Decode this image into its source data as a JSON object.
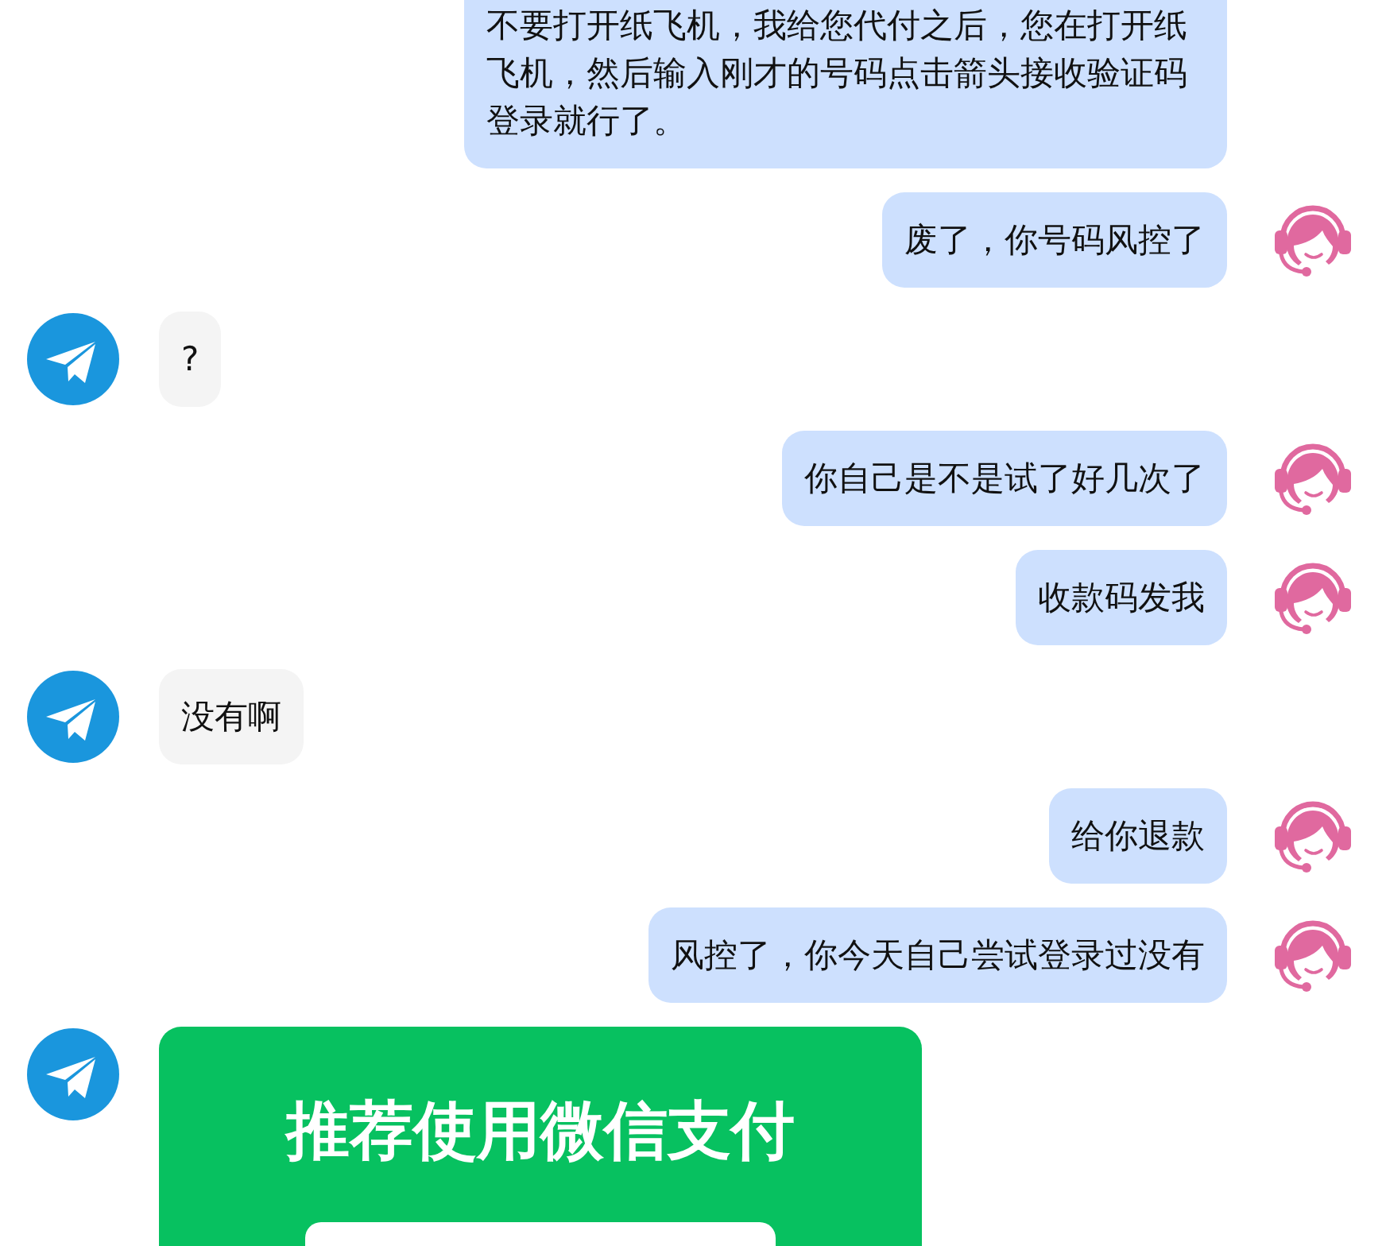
{
  "messages": [
    {
      "kind": "outgoing_text",
      "avatar_shown": false,
      "text": "不要打开纸飞机，我给您代付之后，您在打开纸飞机，然后输入刚才的号码点击箭头接收验证码登录就行了。"
    },
    {
      "kind": "outgoing_text",
      "avatar_shown": true,
      "text": "废了，你号码风控了"
    },
    {
      "kind": "incoming_text",
      "avatar_shown": true,
      "text": "?"
    },
    {
      "kind": "outgoing_text",
      "avatar_shown": true,
      "text": "你自己是不是试了好几次了"
    },
    {
      "kind": "outgoing_text",
      "avatar_shown": true,
      "text": "收款码发我"
    },
    {
      "kind": "incoming_text",
      "avatar_shown": true,
      "text": "没有啊"
    },
    {
      "kind": "outgoing_text",
      "avatar_shown": true,
      "text": "给你退款"
    },
    {
      "kind": "outgoing_text",
      "avatar_shown": true,
      "text": "风控了，你今天自己尝试登录过没有"
    },
    {
      "kind": "incoming_card",
      "avatar_shown": true,
      "title": "推荐使用微信支付"
    }
  ]
}
